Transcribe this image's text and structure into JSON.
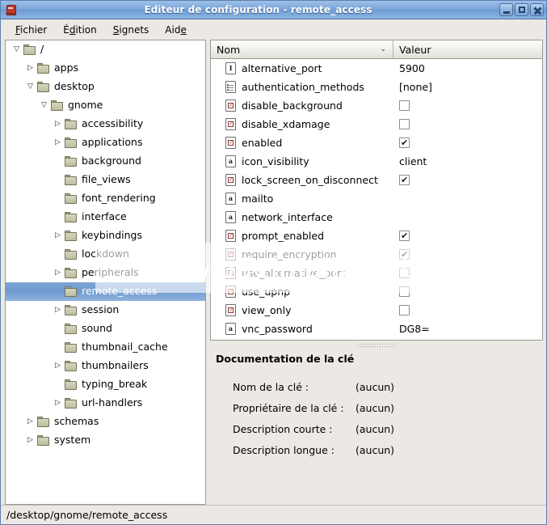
{
  "window": {
    "title": "Éditeur de configuration - remote_access",
    "app_icon": "config-editor-icon",
    "buttons": {
      "minimize": "minimize-icon",
      "maximize": "maximize-icon",
      "close": "close-icon"
    }
  },
  "menubar": {
    "items": [
      {
        "label": "Fichier",
        "mnemonic_index": 0
      },
      {
        "label": "Édition",
        "mnemonic_index": 1
      },
      {
        "label": "Signets",
        "mnemonic_index": 0
      },
      {
        "label": "Aide",
        "mnemonic_index": 3
      }
    ]
  },
  "tree": {
    "nodes": [
      {
        "label": "/",
        "depth": 0,
        "expander": "expanded",
        "selected": false
      },
      {
        "label": "apps",
        "depth": 1,
        "expander": "collapsed",
        "selected": false
      },
      {
        "label": "desktop",
        "depth": 1,
        "expander": "expanded",
        "selected": false
      },
      {
        "label": "gnome",
        "depth": 2,
        "expander": "expanded",
        "selected": false
      },
      {
        "label": "accessibility",
        "depth": 3,
        "expander": "collapsed",
        "selected": false
      },
      {
        "label": "applications",
        "depth": 3,
        "expander": "collapsed",
        "selected": false
      },
      {
        "label": "background",
        "depth": 3,
        "expander": "none",
        "selected": false
      },
      {
        "label": "file_views",
        "depth": 3,
        "expander": "none",
        "selected": false
      },
      {
        "label": "font_rendering",
        "depth": 3,
        "expander": "none",
        "selected": false
      },
      {
        "label": "interface",
        "depth": 3,
        "expander": "none",
        "selected": false
      },
      {
        "label": "keybindings",
        "depth": 3,
        "expander": "collapsed",
        "selected": false
      },
      {
        "label": "lockdown",
        "depth": 3,
        "expander": "none",
        "selected": false
      },
      {
        "label": "peripherals",
        "depth": 3,
        "expander": "collapsed",
        "selected": false
      },
      {
        "label": "remote_access",
        "depth": 3,
        "expander": "none",
        "selected": true
      },
      {
        "label": "session",
        "depth": 3,
        "expander": "collapsed",
        "selected": false
      },
      {
        "label": "sound",
        "depth": 3,
        "expander": "none",
        "selected": false
      },
      {
        "label": "thumbnail_cache",
        "depth": 3,
        "expander": "none",
        "selected": false
      },
      {
        "label": "thumbnailers",
        "depth": 3,
        "expander": "collapsed",
        "selected": false
      },
      {
        "label": "typing_break",
        "depth": 3,
        "expander": "none",
        "selected": false
      },
      {
        "label": "url-handlers",
        "depth": 3,
        "expander": "collapsed",
        "selected": false
      },
      {
        "label": "schemas",
        "depth": 1,
        "expander": "collapsed",
        "selected": false
      },
      {
        "label": "system",
        "depth": 1,
        "expander": "collapsed",
        "selected": false
      }
    ],
    "expander_glyphs": {
      "expanded": "▽",
      "collapsed": "▷",
      "none": ""
    }
  },
  "keylist": {
    "columns": {
      "name": "Nom",
      "value": "Valeur"
    },
    "sort_indicator": "⌄",
    "rows": [
      {
        "name": "alternative_port",
        "icon": "int-type-icon",
        "value_type": "text",
        "value": "5900"
      },
      {
        "name": "authentication_methods",
        "icon": "list-type-icon",
        "value_type": "text",
        "value": "[none]"
      },
      {
        "name": "disable_background",
        "icon": "bool-type-icon",
        "value_type": "checkbox",
        "value": false
      },
      {
        "name": "disable_xdamage",
        "icon": "bool-type-icon",
        "value_type": "checkbox",
        "value": false
      },
      {
        "name": "enabled",
        "icon": "bool-type-icon",
        "value_type": "checkbox",
        "value": true
      },
      {
        "name": "icon_visibility",
        "icon": "string-type-icon",
        "value_type": "text",
        "value": "client"
      },
      {
        "name": "lock_screen_on_disconnect",
        "icon": "bool-type-icon",
        "value_type": "checkbox",
        "value": true
      },
      {
        "name": "mailto",
        "icon": "string-type-icon",
        "value_type": "text",
        "value": ""
      },
      {
        "name": "network_interface",
        "icon": "string-type-icon",
        "value_type": "text",
        "value": ""
      },
      {
        "name": "prompt_enabled",
        "icon": "bool-type-icon",
        "value_type": "checkbox",
        "value": true
      },
      {
        "name": "require_encryption",
        "icon": "bool-type-icon",
        "value_type": "checkbox",
        "value": true
      },
      {
        "name": "use_alternative_port",
        "icon": "bool-type-icon",
        "value_type": "checkbox",
        "value": false
      },
      {
        "name": "use_upnp",
        "icon": "bool-type-icon",
        "value_type": "checkbox",
        "value": false
      },
      {
        "name": "view_only",
        "icon": "bool-type-icon",
        "value_type": "checkbox",
        "value": false
      },
      {
        "name": "vnc_password",
        "icon": "string-type-icon",
        "value_type": "text",
        "value": "DG8="
      }
    ]
  },
  "documentation": {
    "title": "Documentation de la clé",
    "fields": [
      {
        "label": "Nom de la clé :",
        "value": "(aucun)"
      },
      {
        "label": "Propriétaire de la clé :",
        "value": "(aucun)"
      },
      {
        "label": "Description courte :",
        "value": "(aucun)"
      },
      {
        "label": "Description longue :",
        "value": "(aucun)"
      }
    ]
  },
  "statusbar": {
    "path": "/desktop/gnome/remote_access"
  },
  "watermark": {
    "text": "www.odelmalin.net"
  }
}
